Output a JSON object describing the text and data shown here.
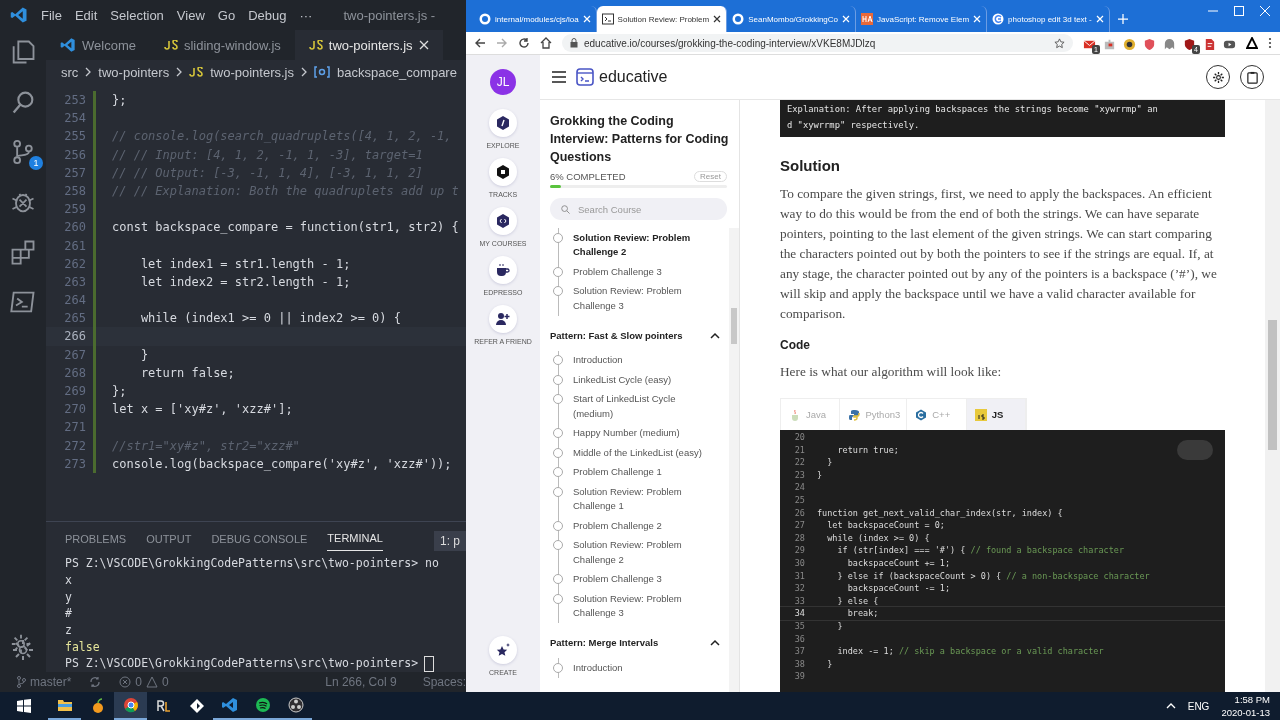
{
  "vscode": {
    "menu": [
      "File",
      "Edit",
      "Selection",
      "View",
      "Go",
      "Debug",
      "···"
    ],
    "title": "two-pointers.js -",
    "activity": [
      {
        "kind": "explorer"
      },
      {
        "kind": "search"
      },
      {
        "kind": "git",
        "badge": "1"
      },
      {
        "kind": "debug"
      },
      {
        "kind": "extensions"
      },
      {
        "kind": "terminal"
      }
    ],
    "tabs": [
      {
        "label": "Welcome",
        "kind": "vscode",
        "selected": false
      },
      {
        "label": "sliding-window.js",
        "kind": "js",
        "selected": false
      },
      {
        "label": "two-pointers.js",
        "kind": "js",
        "selected": true
      }
    ],
    "breadcrumb": [
      {
        "label": "src",
        "kind": "folder"
      },
      {
        "label": "two-pointers",
        "kind": "folder"
      },
      {
        "label": "two-pointers.js",
        "kind": "js"
      },
      {
        "label": "backspace_compare",
        "kind": "symbol"
      }
    ],
    "lines": [
      {
        "n": "253",
        "code": "};",
        "current": false
      },
      {
        "n": "254",
        "current": false
      },
      {
        "n": "255",
        "comment": "// console.log(search_quadruplets([4, 1, 2, -1,",
        "current": false
      },
      {
        "n": "256",
        "comment": "// // Input: [4, 1, 2, -1, 1, -3], target=1",
        "current": false
      },
      {
        "n": "257",
        "comment": "// // Output: [-3, -1, 1, 4], [-3, 1, 1, 2]",
        "current": false
      },
      {
        "n": "258",
        "comment": "// // Explanation: Both the quadruplets add up t",
        "current": false
      },
      {
        "n": "259",
        "current": false
      },
      {
        "n": "260",
        "code": "const backspace_compare = function(str1, str2) {",
        "current": false
      },
      {
        "n": "261",
        "current": false
      },
      {
        "n": "262",
        "code": "    let index1 = str1.length - 1;",
        "current": false
      },
      {
        "n": "263",
        "code": "    let index2 = str2.length - 1;",
        "current": false
      },
      {
        "n": "264",
        "current": false
      },
      {
        "n": "265",
        "code": "    while (index1 >= 0 || index2 >= 0) {",
        "current": false
      },
      {
        "n": "266",
        "current": true
      },
      {
        "n": "267",
        "code": "    }",
        "current": false
      },
      {
        "n": "268",
        "code": "    return false;",
        "current": false
      },
      {
        "n": "269",
        "code": "};",
        "current": false
      },
      {
        "n": "270",
        "code": "let x = ['xy#z', 'xzz#'];",
        "current": false
      },
      {
        "n": "271",
        "current": false
      },
      {
        "n": "272",
        "comment": "//str1=\"xy#z\", str2=\"xzz#\"",
        "current": false
      },
      {
        "n": "273",
        "code": "console.log(backspace_compare('xy#z', 'xzz#'));",
        "current": false
      }
    ],
    "panel_tabs": [
      {
        "label": "PROBLEMS",
        "selected": false
      },
      {
        "label": "OUTPUT",
        "selected": false
      },
      {
        "label": "DEBUG CONSOLE",
        "selected": false
      },
      {
        "label": "TERMINAL",
        "selected": true
      }
    ],
    "terminal_select": "1: p",
    "terminal": [
      {
        "text": "PS Z:\\VSCODE\\GrokkingCodePatterns\\src\\two-pointers> no",
        "kind": "prompt"
      },
      {
        "text": "x",
        "kind": "output"
      },
      {
        "text": "y",
        "kind": "output"
      },
      {
        "text": "#",
        "kind": "output"
      },
      {
        "text": "z",
        "kind": "output"
      },
      {
        "text": "false",
        "kind": "value"
      },
      {
        "text": "PS Z:\\VSCODE\\GrokkingCodePatterns\\src\\two-pointers>",
        "kind": "cursor"
      }
    ],
    "status": {
      "branch": "master*",
      "errors": "0",
      "warnings": "0",
      "position": "Ln 266, Col 9",
      "spaces": "Spaces:"
    }
  },
  "browser": {
    "tabs": [
      {
        "title": "internal/modules/cjs/loa",
        "kind": "github",
        "selected": false
      },
      {
        "title": "Solution Review: Problem",
        "kind": "terminal",
        "selected": true
      },
      {
        "title": "SeanMombo/GrokkingCo",
        "kind": "github",
        "selected": false
      },
      {
        "title": "JavaScript: Remove Elem",
        "kind": "ha",
        "selected": false
      },
      {
        "title": "photoshop edit 3d text -",
        "kind": "google",
        "selected": false
      }
    ],
    "url": "educative.io/courses/grokking-the-coding-interview/xVKE8MJDlzq",
    "extensions": [
      {
        "kind": "mail",
        "badge": "1"
      },
      {
        "kind": "puzzle"
      },
      {
        "kind": "coin"
      },
      {
        "kind": "shield"
      },
      {
        "kind": "ghost"
      },
      {
        "kind": "block",
        "badge": "4"
      },
      {
        "kind": "pdf"
      },
      {
        "kind": "media"
      }
    ]
  },
  "educative": {
    "avatar": "JL",
    "logo": "educative",
    "rail": [
      {
        "label": "EXPLORE",
        "kind": "explore"
      },
      {
        "label": "TRACKS",
        "kind": "tracks"
      },
      {
        "label": "MY COURSES",
        "kind": "courses"
      },
      {
        "label": "EDPRESSO",
        "kind": "cup"
      },
      {
        "label": "REFER A FRIEND",
        "kind": "refer"
      }
    ],
    "create": "CREATE",
    "course": {
      "title": "Grokking the Coding Interview: Patterns for Coding Questions",
      "progress": "6% COMPLETED",
      "level": 0.06,
      "reset": "Reset",
      "search": {
        "placeholder": "Search Course"
      },
      "sections": [
        {
          "items": [
            {
              "label": "Solution Review: Problem Challenge 2",
              "selected": true
            },
            {
              "label": "Problem Challenge 3",
              "selected": false
            },
            {
              "label": "Solution Review: Problem Challenge 3",
              "selected": false
            }
          ]
        },
        {
          "title": "Pattern: Fast & Slow pointers",
          "expanded": true,
          "items": [
            {
              "label": "Introduction",
              "selected": false
            },
            {
              "label": "LinkedList Cycle (easy)",
              "selected": false
            },
            {
              "label": "Start of LinkedList Cycle (medium)",
              "selected": false
            },
            {
              "label": "Happy Number (medium)",
              "selected": false
            },
            {
              "label": "Middle of the LinkedList (easy)",
              "selected": false
            },
            {
              "label": "Problem Challenge 1",
              "selected": false
            },
            {
              "label": "Solution Review: Problem Challenge 1",
              "selected": false
            },
            {
              "label": "Problem Challenge 2",
              "selected": false
            },
            {
              "label": "Solution Review: Problem Challenge 2",
              "selected": false
            },
            {
              "label": "Problem Challenge 3",
              "selected": false
            },
            {
              "label": "Solution Review: Problem Challenge 3",
              "selected": false
            }
          ]
        },
        {
          "title": "Pattern: Merge Intervals",
          "expanded": true,
          "items": [
            {
              "label": "Introduction",
              "selected": false
            }
          ]
        }
      ]
    },
    "content": {
      "explanation": [
        "Explanation: After applying backspaces the strings become \"xywrrmp\" an",
        "d \"xywrrmp\" respectively."
      ],
      "heading": "Solution",
      "paragraph": "To compare the given strings, first, we need to apply the backspaces. An efficient way to do this would be from the end of both the strings. We can have separate pointers, pointing to the last element of the given strings. We can start comparing the characters pointed out by both the pointers to see if the strings are equal. If, at any stage, the character pointed out by any of the pointers is a backspace (’#’), we will skip and apply the backspace until we have a valid character available for comparison.",
      "subheading": "Code",
      "intro": "Here is what our algorithm will look like:",
      "languages": [
        {
          "label": "Java",
          "kind": "java",
          "selected": false
        },
        {
          "label": "Python3",
          "kind": "python",
          "selected": false
        },
        {
          "label": "C++",
          "kind": "cpp",
          "selected": false
        },
        {
          "label": "JS",
          "kind": "js",
          "selected": true
        }
      ],
      "lines": [
        {
          "n": "20",
          "current": false
        },
        {
          "n": "21",
          "code": "    return true;",
          "current": false
        },
        {
          "n": "22",
          "code": "  }",
          "current": false
        },
        {
          "n": "23",
          "code": "}",
          "current": false
        },
        {
          "n": "24",
          "current": false
        },
        {
          "n": "25",
          "current": false
        },
        {
          "n": "26",
          "code": "function get_next_valid_char_index(str, index) {",
          "current": false
        },
        {
          "n": "27",
          "code": "  let backspaceCount = 0;",
          "current": false
        },
        {
          "n": "28",
          "code": "  while (index >= 0) {",
          "current": false
        },
        {
          "n": "29",
          "code": "    if (str[index] === '#') { ",
          "comment": "// found a backspace character",
          "current": false
        },
        {
          "n": "30",
          "code": "      backspaceCount += 1;",
          "current": false
        },
        {
          "n": "31",
          "code": "    } else if (backspaceCount > 0) { ",
          "comment": "// a non-backspace character",
          "current": false
        },
        {
          "n": "32",
          "code": "      backspaceCount -= 1;",
          "current": false
        },
        {
          "n": "33",
          "code": "    } else {",
          "current": false
        },
        {
          "n": "34",
          "code": "      break;",
          "current": true
        },
        {
          "n": "35",
          "code": "    }",
          "current": false
        },
        {
          "n": "36",
          "current": false
        },
        {
          "n": "37",
          "code": "    index -= 1; ",
          "comment": "// skip a backspace or a valid character",
          "current": false
        },
        {
          "n": "38",
          "code": "  }",
          "current": false
        },
        {
          "n": "39",
          "current": false
        }
      ]
    }
  },
  "taskbar": {
    "apps": [
      {
        "kind": "explorer",
        "running": true,
        "selected": false
      },
      {
        "kind": "fl",
        "running": false,
        "selected": false
      },
      {
        "kind": "chrome",
        "running": true,
        "selected": true
      },
      {
        "kind": "rl",
        "running": false,
        "selected": false
      },
      {
        "kind": "diamond",
        "running": false,
        "selected": false
      },
      {
        "kind": "vscode",
        "running": true,
        "selected": false
      },
      {
        "kind": "spotify",
        "running": true,
        "selected": false
      },
      {
        "kind": "obs",
        "running": true,
        "selected": false
      }
    ],
    "language": "ENG",
    "time": "1:58 PM",
    "date": "2020-01-13"
  }
}
